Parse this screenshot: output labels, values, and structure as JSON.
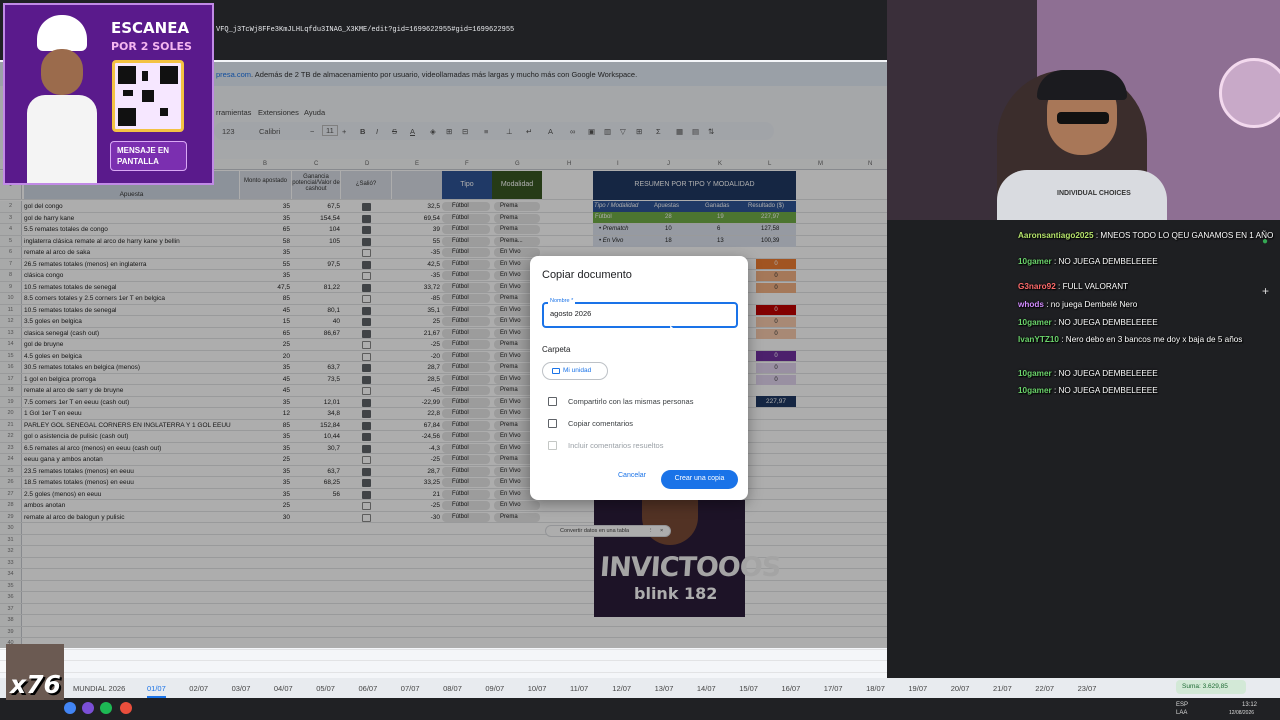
{
  "browser": {
    "url": "VFQ_j3TcWj8FFe3KmJLHLqfdu3INAG_X3KME/edit?gid=1699622955#gid=1699622955",
    "banner_link": "presa.com",
    "banner_text": ". Además de 2 TB de almacenamiento por usuario, videollamadas más largas y mucho más con Google Workspace.",
    "menu": [
      "rramientas",
      "Extensiones",
      "Ayuda"
    ],
    "toolbar": {
      "zoom_num": "123",
      "font": "Calibri",
      "size": "11"
    }
  },
  "sheet": {
    "columns": [
      "B",
      "C",
      "D",
      "E",
      "F",
      "G",
      "H",
      "I",
      "J",
      "K",
      "L",
      "M",
      "N"
    ],
    "header": {
      "a": "Apuesta",
      "b": "Monto apostado",
      "c": "Ganancia potencial/Valor de cashout",
      "d": "¿Salió?",
      "f": "Tipo",
      "g": "Modalidad"
    },
    "rows": [
      {
        "n": "2",
        "a": "gol del congo",
        "b": "35",
        "c": "67,5",
        "d": true,
        "e": "32,5",
        "f": "Fútbol",
        "g": "Prema"
      },
      {
        "n": "3",
        "a": "gol de harry kane",
        "b": "35",
        "c": "154,54",
        "d": true,
        "e": "69,54",
        "f": "Fútbol",
        "g": "Prema"
      },
      {
        "n": "4",
        "a": "5.5 remates totales de congo",
        "b": "65",
        "c": "104",
        "d": true,
        "e": "39",
        "f": "Fútbol",
        "g": "Prema"
      },
      {
        "n": "5",
        "a": "inglaterra clásica remate al arco de harry kane y bellin",
        "b": "58",
        "c": "105",
        "d": true,
        "e": "55",
        "f": "Fútbol",
        "g": "Prema..."
      },
      {
        "n": "6",
        "a": "remate al arco de saka",
        "b": "35",
        "c": "",
        "d": false,
        "e": "-35",
        "f": "Fútbol",
        "g": "En Vivo"
      },
      {
        "n": "7",
        "a": "26.5 remates totales (menos) en inglaterra",
        "b": "55",
        "c": "97,5",
        "d": true,
        "e": "42,5",
        "f": "Fútbol",
        "g": "En Vivo"
      },
      {
        "n": "8",
        "a": "clásica congo",
        "b": "35",
        "c": "",
        "d": false,
        "e": "-35",
        "f": "Fútbol",
        "g": "En Vivo"
      },
      {
        "n": "9",
        "a": "10.5 remates totales de senegal",
        "b": "47,5",
        "c": "81,22",
        "d": true,
        "e": "33,72",
        "f": "Fútbol",
        "g": "En Vivo"
      },
      {
        "n": "10",
        "a": "8.5 corners totales y 2.5 corners 1er T en belgica",
        "b": "85",
        "c": "",
        "d": false,
        "e": "-85",
        "f": "Fútbol",
        "g": "Prema"
      },
      {
        "n": "11",
        "a": "10.5 remates totales de senegal",
        "b": "45",
        "c": "80,1",
        "d": true,
        "e": "35,1",
        "f": "Fútbol",
        "g": "En Vivo"
      },
      {
        "n": "12",
        "a": "3.5 goles en belgica",
        "b": "15",
        "c": "40",
        "d": true,
        "e": "25",
        "f": "Fútbol",
        "g": "En Vivo"
      },
      {
        "n": "13",
        "a": "clasica senegal (cash out)",
        "b": "65",
        "c": "86,67",
        "d": true,
        "e": "21,67",
        "f": "Fútbol",
        "g": "En Vivo"
      },
      {
        "n": "14",
        "a": "gol de bruyne",
        "b": "25",
        "c": "",
        "d": false,
        "e": "-25",
        "f": "Fútbol",
        "g": "Prema"
      },
      {
        "n": "15",
        "a": "4.5 goles en belgica",
        "b": "20",
        "c": "",
        "d": false,
        "e": "-20",
        "f": "Fútbol",
        "g": "En Vivo"
      },
      {
        "n": "16",
        "a": "30.5 remates totales en belgica (menos)",
        "b": "35",
        "c": "63,7",
        "d": true,
        "e": "28,7",
        "f": "Fútbol",
        "g": "Prema"
      },
      {
        "n": "17",
        "a": "1 gol en belgica prorroga",
        "b": "45",
        "c": "73,5",
        "d": true,
        "e": "28,5",
        "f": "Fútbol",
        "g": "En Vivo"
      },
      {
        "n": "18",
        "a": "remate al arco de sarr y de bruyne",
        "b": "45",
        "c": "",
        "d": false,
        "e": "-45",
        "f": "Fútbol",
        "g": "Prema"
      },
      {
        "n": "19",
        "a": "7.5 corners 1er T en eeuu (cash out)",
        "b": "35",
        "c": "12,01",
        "d": true,
        "e": "-22,99",
        "f": "Fútbol",
        "g": "En Vivo"
      },
      {
        "n": "20",
        "a": "1 Gol 1er T en eeuu",
        "b": "12",
        "c": "34,8",
        "d": true,
        "e": "22,8",
        "f": "Fútbol",
        "g": "En Vivo"
      },
      {
        "n": "21",
        "a": "PARLEY GOL SENEGAL CORNERS EN INGLATERRA Y 1 GOL EEUU",
        "b": "85",
        "c": "152,84",
        "d": true,
        "e": "67,84",
        "f": "Fútbol",
        "g": "Prema"
      },
      {
        "n": "22",
        "a": "gol o asistencia de pulisic (cash out)",
        "b": "35",
        "c": "10,44",
        "d": true,
        "e": "-24,56",
        "f": "Fútbol",
        "g": "En Vivo"
      },
      {
        "n": "23",
        "a": "6.5 remates al arco (menos) en eeuu (cash out)",
        "b": "35",
        "c": "30,7",
        "d": true,
        "e": "-4,3",
        "f": "Fútbol",
        "g": "En Vivo"
      },
      {
        "n": "24",
        "a": "eeuu gana y ambos anotan",
        "b": "25",
        "c": "",
        "d": false,
        "e": "-25",
        "f": "Fútbol",
        "g": "Prema"
      },
      {
        "n": "25",
        "a": "23.5 remates totales (menos) en eeuu",
        "b": "35",
        "c": "63,7",
        "d": true,
        "e": "28,7",
        "f": "Fútbol",
        "g": "En Vivo"
      },
      {
        "n": "26",
        "a": "18.5 remates totales (menos) en eeuu",
        "b": "35",
        "c": "68,25",
        "d": true,
        "e": "33,25",
        "f": "Fútbol",
        "g": "En Vivo"
      },
      {
        "n": "27",
        "a": "2.5 goles (menos) en eeuu",
        "b": "35",
        "c": "56",
        "d": true,
        "e": "21",
        "f": "Fútbol",
        "g": "En Vivo"
      },
      {
        "n": "28",
        "a": "ambos anotan",
        "b": "25",
        "c": "",
        "d": false,
        "e": "-25",
        "f": "Fútbol",
        "g": "En Vivo"
      },
      {
        "n": "29",
        "a": "remate al arco de balogun y pulisic",
        "b": "30",
        "c": "",
        "d": false,
        "e": "-30",
        "f": "Fútbol",
        "g": "Prema"
      }
    ],
    "empty_rows": [
      "30",
      "31",
      "32",
      "33",
      "34",
      "35",
      "36",
      "37",
      "38",
      "39",
      "40",
      "41",
      "42"
    ],
    "summary": {
      "title": "RESUMEN POR TIPO Y MODALIDAD",
      "headers": [
        "Tipo / Modalidad",
        "Apuestas",
        "Ganadas",
        "Resultado ($)"
      ],
      "rows": [
        {
          "label": "Fútbol",
          "apuestas": "28",
          "ganadas": "19",
          "resultado": "227,97"
        },
        {
          "label": "• Prematch",
          "apuestas": "10",
          "ganadas": "6",
          "resultado": "127,58"
        },
        {
          "label": "• En Vivo",
          "apuestas": "18",
          "ganadas": "13",
          "resultado": "100,39"
        }
      ],
      "zeros": [
        "0",
        "0",
        "0",
        "0",
        "0",
        "0",
        "0",
        "0",
        "0"
      ],
      "total": "227,97"
    },
    "thumbnail": {
      "title": "INVICTOOOS",
      "sub": "blink 182"
    },
    "chip": "Convertir datos en una tabla"
  },
  "dialog": {
    "title": "Copiar documento",
    "name_label": "Nombre *",
    "name_value": "agosto 2026",
    "folder_label": "Carpeta",
    "folder_button": "Mi unidad",
    "options": [
      "Compartirlo con las mismas personas",
      "Copiar comentarios",
      "Incluir comentarios resueltos"
    ],
    "cancel": "Cancelar",
    "create": "Crear una copia"
  },
  "tabs": {
    "items": [
      "MUNDIAL 2026",
      "01/07",
      "02/07",
      "03/07",
      "04/07",
      "05/07",
      "06/07",
      "07/07",
      "08/07",
      "09/07",
      "10/07",
      "11/07",
      "12/07",
      "13/07",
      "14/07",
      "15/07",
      "16/07",
      "17/07",
      "18/07",
      "19/07",
      "20/07",
      "21/07",
      "22/07",
      "23/07"
    ],
    "active": "01/07",
    "sum": "Suma: 3.629,85"
  },
  "taskbar": {
    "lang": "ESP",
    "region": "LAA",
    "time": "13:12",
    "date": "12/08/2026"
  },
  "promo": {
    "title": "ESCANEA",
    "subtitle": "POR 2 SOLES",
    "button": "MENSAJE EN PANTALLA"
  },
  "webcam": {
    "shirt_text": "INDIVIDUAL CHOICES"
  },
  "overlay_badge": "x76",
  "chat": [
    {
      "user": "Aaronsantiago2025",
      "text": "MNEOS TODO LO QEU GANAMOS EN 1 AÑO",
      "color": "#b5e36b"
    },
    {
      "user": "10gamer",
      "text": "NO JUEGA DEMBELEEEE",
      "color": "#6bd36b"
    },
    {
      "user": "G3naro92",
      "text": "FULL VALORANT",
      "color": "#ff6b6b"
    },
    {
      "user": "whods",
      "text": "no juega Dembelé Nero",
      "color": "#d28bff"
    },
    {
      "user": "10gamer",
      "text": "NO JUEGA DEMBELEEEE",
      "color": "#6bd36b"
    },
    {
      "user": "IvanYTZ10",
      "text": "Nero debo en 3 bancos me doy x baja de 5 años",
      "color": "#6bd36b"
    },
    {
      "user": "10gamer",
      "text": "NO JUEGA DEMBELEEEE",
      "color": "#6bd36b"
    },
    {
      "user": "10gamer",
      "text": "NO JUEGA DEMBELEEEE",
      "color": "#6bd36b"
    }
  ]
}
